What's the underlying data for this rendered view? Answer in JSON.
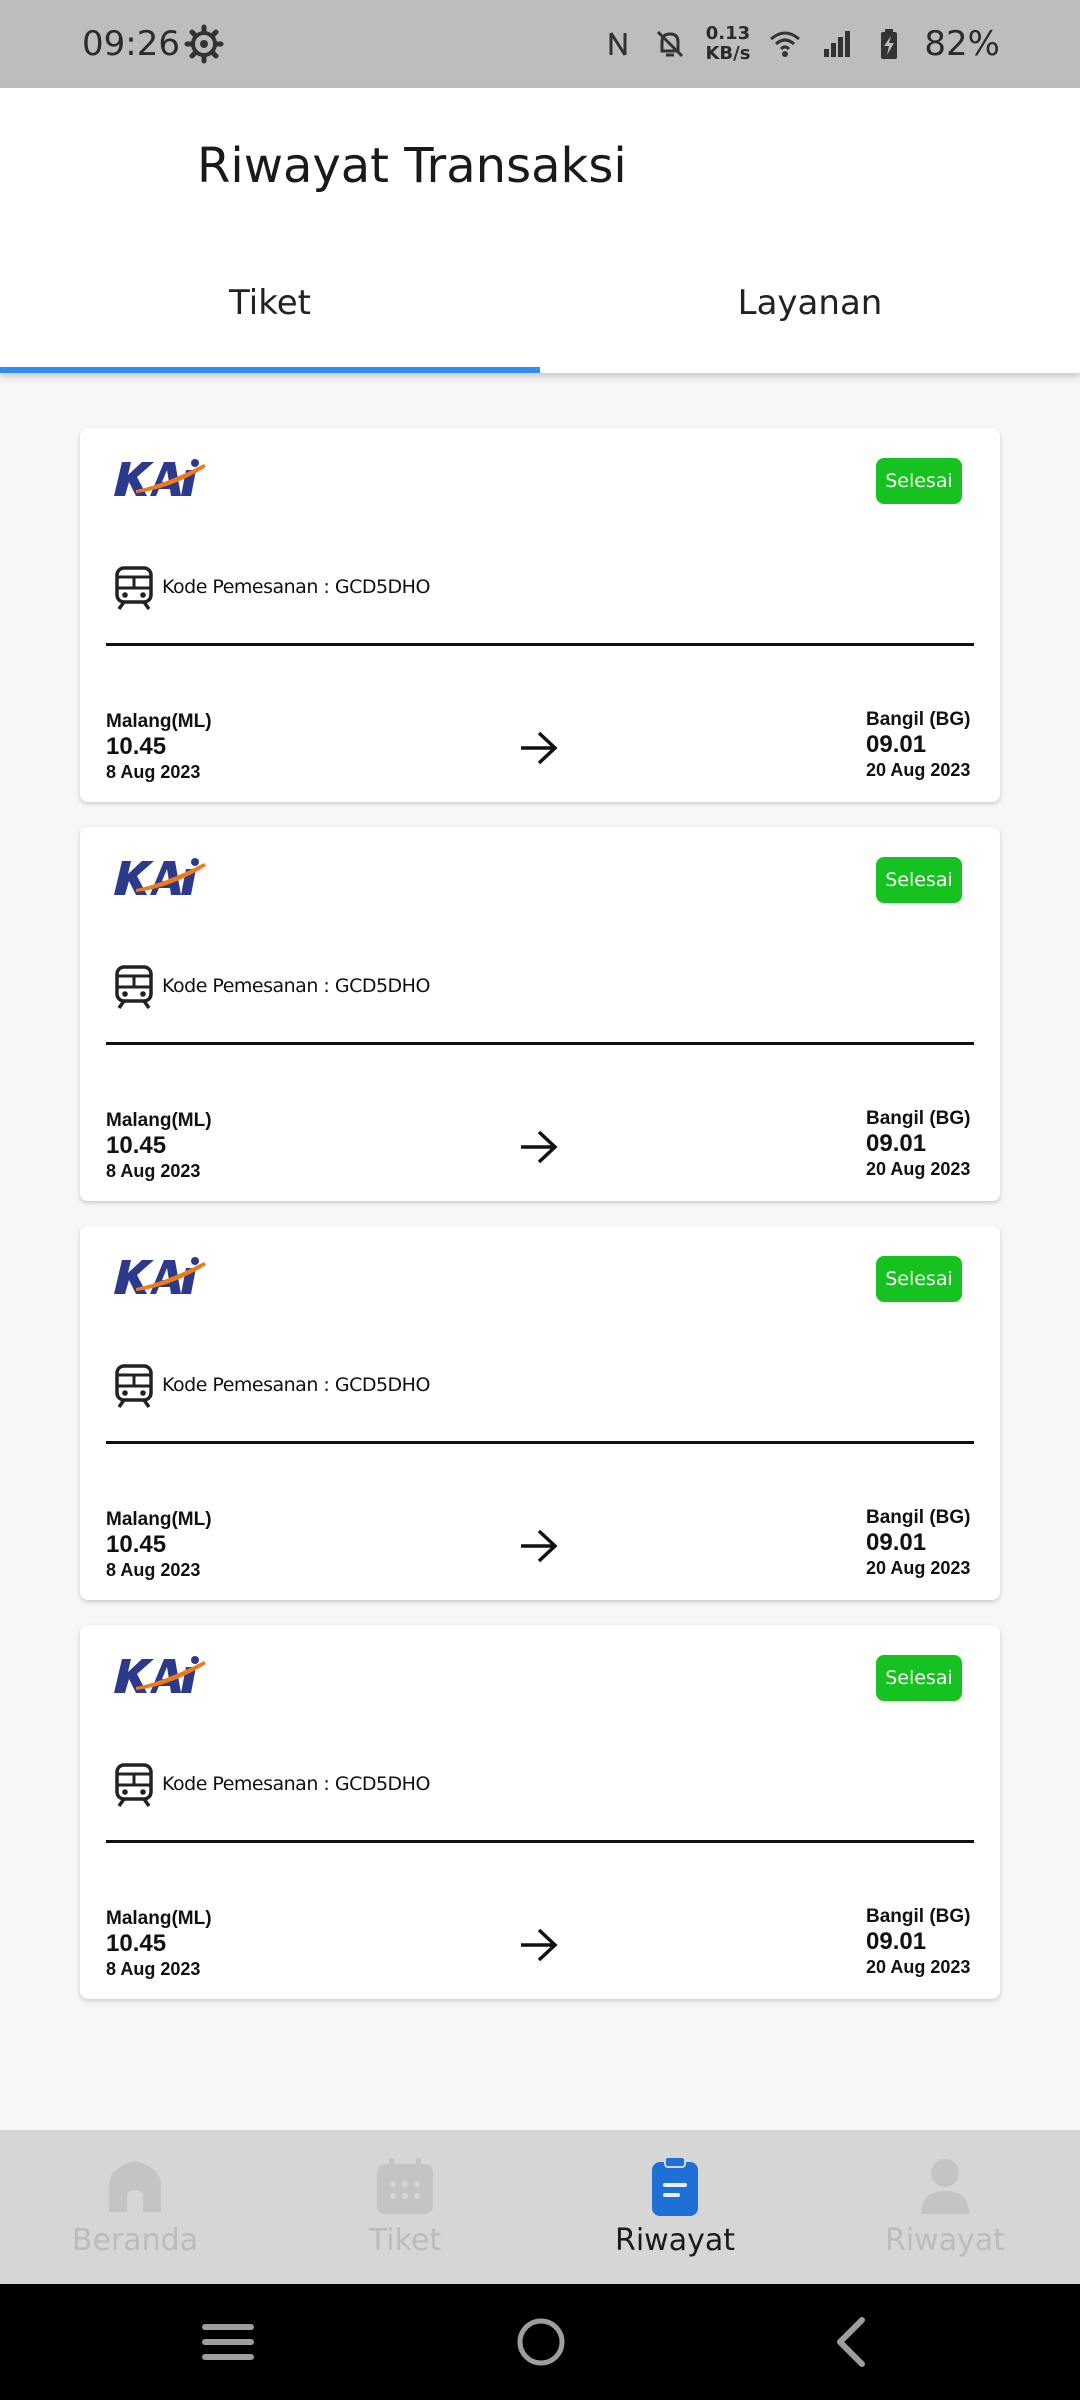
{
  "status_bar": {
    "time": "09:26",
    "net_speed_value": "0.13",
    "net_speed_unit": "KB/s",
    "battery": "82%",
    "icons": [
      "gear-icon",
      "nfc-icon",
      "bell-off-icon",
      "wifi-icon",
      "signal-icon",
      "battery-charging-icon"
    ]
  },
  "header": {
    "title": "Riwayat Transaksi",
    "tabs": [
      {
        "label": "Tiket",
        "active": true
      },
      {
        "label": "Layanan",
        "active": false
      }
    ]
  },
  "colors": {
    "accent": "#2f8ef0",
    "badge_green": "#15c21f",
    "kai_blue": "#2d3a8c",
    "kai_orange": "#f07a1a",
    "active_nav": "#1e6fd6"
  },
  "tickets": [
    {
      "logo": "KAI",
      "status": "Selesai",
      "booking_label": "Kode Pemesanan : GCD5DHO",
      "origin": {
        "station": "Malang(ML)",
        "time": "10.45",
        "date": "8 Aug 2023"
      },
      "destination": {
        "station": "Bangil (BG)",
        "time": "09.01",
        "date": "20 Aug 2023"
      }
    },
    {
      "logo": "KAI",
      "status": "Selesai",
      "booking_label": "Kode Pemesanan : GCD5DHO",
      "origin": {
        "station": "Malang(ML)",
        "time": "10.45",
        "date": "8 Aug 2023"
      },
      "destination": {
        "station": "Bangil (BG)",
        "time": "09.01",
        "date": "20 Aug 2023"
      }
    },
    {
      "logo": "KAI",
      "status": "Selesai",
      "booking_label": "Kode Pemesanan : GCD5DHO",
      "origin": {
        "station": "Malang(ML)",
        "time": "10.45",
        "date": "8 Aug 2023"
      },
      "destination": {
        "station": "Bangil (BG)",
        "time": "09.01",
        "date": "20 Aug 2023"
      }
    },
    {
      "logo": "KAI",
      "status": "Selesai",
      "booking_label": "Kode Pemesanan : GCD5DHO",
      "origin": {
        "station": "Malang(ML)",
        "time": "10.45",
        "date": "8 Aug 2023"
      },
      "destination": {
        "station": "Bangil (BG)",
        "time": "09.01",
        "date": "20 Aug 2023"
      }
    }
  ],
  "bottom_nav": [
    {
      "label": "Beranda",
      "icon": "home-icon",
      "active": false
    },
    {
      "label": "Tiket",
      "icon": "calendar-icon",
      "active": false
    },
    {
      "label": "Riwayat",
      "icon": "clipboard-icon",
      "active": true
    },
    {
      "label": "Riwayat",
      "icon": "profile-icon",
      "active": false
    }
  ],
  "system_nav": [
    "menu-icon",
    "home-circle-icon",
    "back-icon"
  ]
}
